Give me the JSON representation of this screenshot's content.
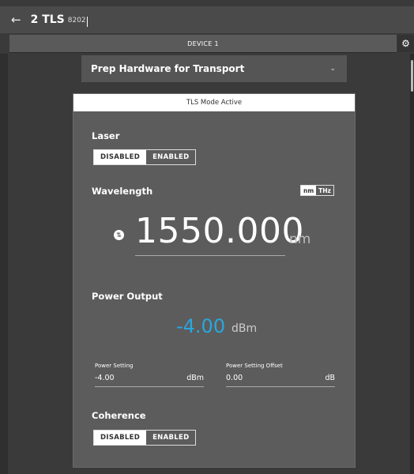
{
  "header": {
    "back_icon": "arrow-left-icon",
    "title": "2 TLS",
    "subtitle": "8202"
  },
  "device_bar": {
    "label": "DEVICE 1",
    "settings_icon": "gear-icon"
  },
  "procedure": {
    "label": "Prep Hardware for Transport",
    "chevron_icon": "chevron-down-icon"
  },
  "panel": {
    "header": "TLS Mode Active",
    "laser": {
      "label": "Laser",
      "disabled": "DISABLED",
      "enabled": "ENABLED",
      "selected": "DISABLED"
    },
    "wavelength": {
      "label": "Wavelength",
      "unit_nm": "nm",
      "unit_thz": "THz",
      "unit_selected": "nm",
      "value": "1550.000",
      "unit": "nm"
    },
    "power": {
      "label": "Power Output",
      "value": "-4.00",
      "unit": "dBm",
      "setting": {
        "label": "Power Setting",
        "value": "-4.00",
        "unit": "dBm"
      },
      "offset": {
        "label": "Power Setting Offset",
        "value": "0.00",
        "unit": "dB"
      }
    },
    "coherence": {
      "label": "Coherence",
      "disabled": "DISABLED",
      "enabled": "ENABLED",
      "selected": "DISABLED"
    }
  },
  "colors": {
    "accent": "#29a7df",
    "background": "#3a3a3a",
    "panel": "#5c5c5c"
  }
}
